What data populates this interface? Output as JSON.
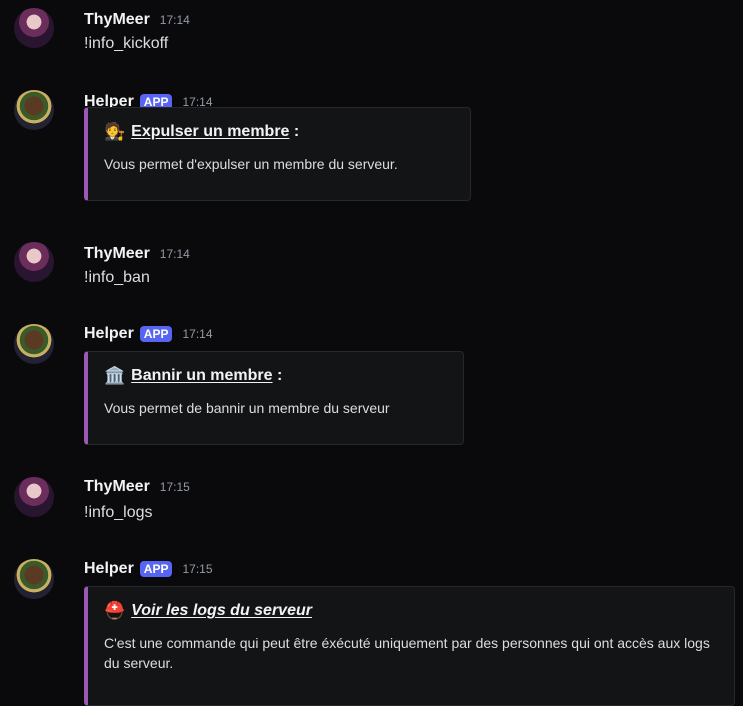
{
  "messages": [
    {
      "author": "ThyMeer",
      "time": "17:14",
      "content": "!info_kickoff"
    },
    {
      "author": "Helper",
      "badge": "APP",
      "time": "17:14",
      "embed": {
        "emoji": "🧑‍⚖️",
        "title": "Expulser un membre",
        "suffix": " :",
        "description": "Vous permet d'expulser un membre du serveur."
      }
    },
    {
      "author": "ThyMeer",
      "time": "17:14",
      "content": "!info_ban"
    },
    {
      "author": "Helper",
      "badge": "APP",
      "time": "17:14",
      "embed": {
        "emoji": "🏛️",
        "title": "Bannir un membre",
        "suffix": " :",
        "description": "Vous permet de bannir un membre du serveur"
      }
    },
    {
      "author": "ThyMeer",
      "time": "17:15",
      "content": "!info_logs"
    },
    {
      "author": "Helper",
      "badge": "APP",
      "time": "17:15",
      "embed": {
        "emoji": "⛑️",
        "title": "Voir les logs du serveur",
        "suffix": "",
        "description": "C'est une commande qui peut être éxécuté uniquement par des personnes qui ont accès aux logs du serveur."
      }
    }
  ],
  "colors": {
    "embed_bar": "#9b59b6",
    "badge": "#5865f2",
    "background": "#0a0a0c"
  }
}
